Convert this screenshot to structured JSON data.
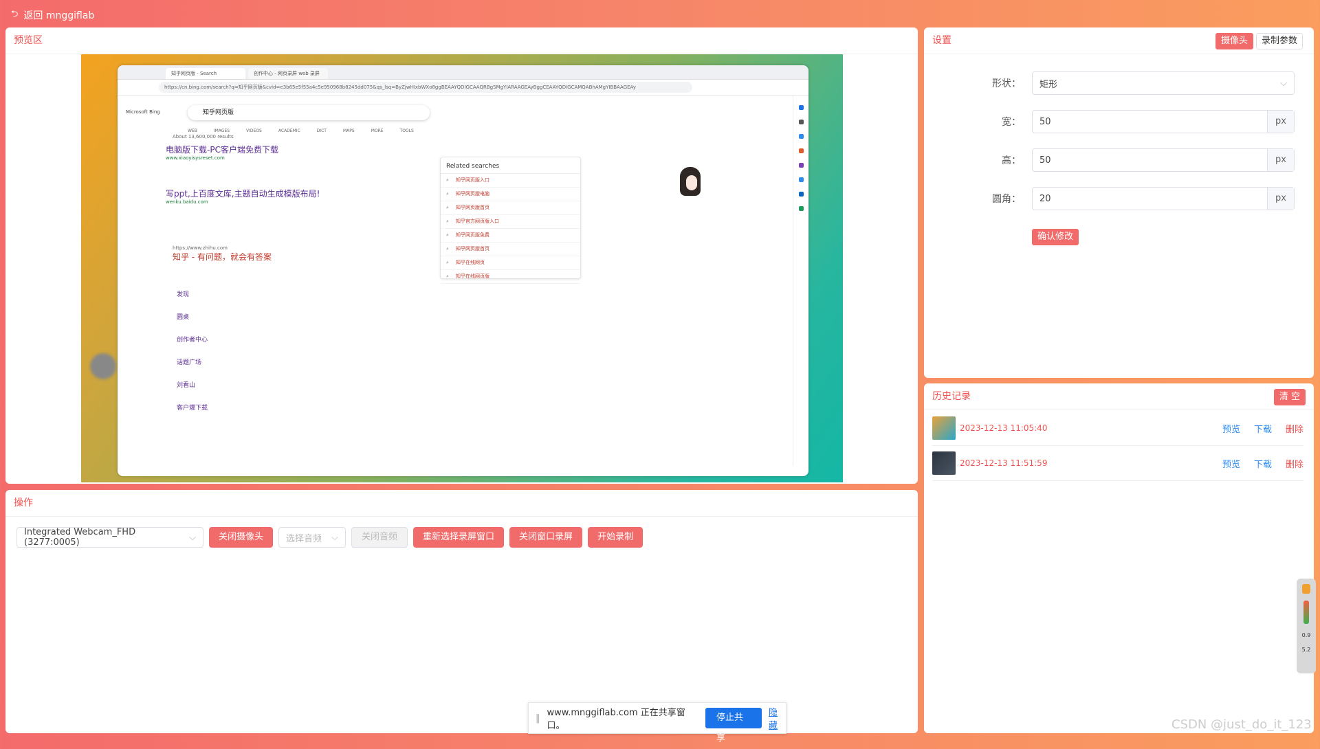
{
  "topbar": {
    "back_label": "返回 mnggiflab"
  },
  "preview": {
    "title": "预览区",
    "browser": {
      "tab1": "知乎网页版 - Search",
      "tab2": "创作中心 - 网页录屏 web 录屏",
      "address": "https://cn.bing.com/search?q=知乎网页版&cvid=e3b65e5f55a4c5e950968b8245dd075&qs_lsq=ByZjwHIxbWXo8ggBEAAYQDIGCAAQRBgSMgYIARAAGEAyBggCEAAYQDIGCAMQABhAMgYIBBAAGEAy",
      "search_query": "知乎网页版",
      "bing_logo": "Microsoft Bing",
      "nav": [
        "WEB",
        "IMAGES",
        "VIDEOS",
        "ACADEMIC",
        "DICT",
        "MAPS",
        "MORE",
        "TOOLS"
      ],
      "results_count": "About 13,600,000 results",
      "result1_title": "电脑版下载-PC客户端免费下载",
      "result1_url": "www.xiaoyisysreset.com",
      "result2_title": "写ppt,上百度文库,主题自动生成模版布局!",
      "result2_url": "wenku.baidu.com",
      "result3_title": "知乎 - 有问题，就会有答案",
      "result3_url": "https://www.zhihu.com",
      "sublinks": [
        "发现",
        "圆桌",
        "创作者中心",
        "话题广场",
        "刘看山",
        "客户端下载"
      ],
      "related_title": "Related searches",
      "related": [
        "知乎网页版入口",
        "知乎网页版电脑",
        "知乎网页版首页",
        "知乎官方网页版入口",
        "知乎网页版免费",
        "知乎网页版首页",
        "知乎在线网页",
        "知乎在线网页版"
      ]
    }
  },
  "ops": {
    "title": "操作",
    "camera_select": "Integrated Webcam_FHD (3277:0005)",
    "close_camera": "关闭摄像头",
    "audio_select_placeholder": "选择音频",
    "close_audio": "关闭音频",
    "reselect_window": "重新选择录屏窗口",
    "close_window_record": "关闭窗口录屏",
    "start_record": "开始录制"
  },
  "share_bar": {
    "text": "www.mnggiflab.com 正在共享窗口。",
    "stop": "停止共享",
    "hide": "隐藏"
  },
  "settings": {
    "title": "设置",
    "tab_camera": "摄像头",
    "tab_record_params": "录制参数",
    "shape_label": "形状：",
    "shape_value": "矩形",
    "width_label": "宽：",
    "width_value": "50",
    "height_label": "高：",
    "height_value": "50",
    "radius_label": "圆角：",
    "radius_value": "20",
    "unit": "px",
    "confirm": "确认修改"
  },
  "history": {
    "title": "历史记录",
    "clear": "清 空",
    "items": [
      {
        "time": "2023-12-13 11:05:40",
        "preview": "预览",
        "download": "下载",
        "delete": "删除"
      },
      {
        "time": "2023-12-13 11:51:59",
        "preview": "预览",
        "download": "下载",
        "delete": "删除"
      }
    ]
  },
  "widget": {
    "val1": "0.9",
    "val2": "5.2"
  },
  "watermark": "CSDN @just_do_it_123",
  "colors": {
    "accent": "#f26b6b",
    "link": "#2d8cf0",
    "share_blue": "#1a73e8"
  }
}
